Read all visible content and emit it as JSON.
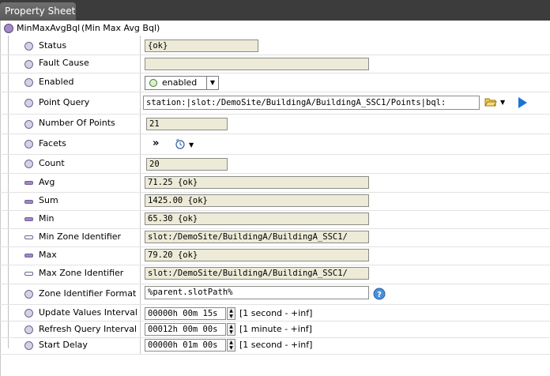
{
  "tab": {
    "label": "Property Sheet"
  },
  "root": {
    "name": "MinMaxAvgBql",
    "description": "(Min Max Avg Bql)"
  },
  "properties": {
    "status": {
      "label": "Status",
      "value": "{ok}"
    },
    "fault_cause": {
      "label": "Fault Cause",
      "value": ""
    },
    "enabled": {
      "label": "Enabled",
      "value": "enabled"
    },
    "point_query": {
      "label": "Point Query",
      "value": "station:|slot:/DemoSite/BuildingA/BuildingA_SSC1/Points|bql:"
    },
    "number_of_points": {
      "label": "Number Of Points",
      "value": "21"
    },
    "facets": {
      "label": "Facets",
      "value": "»"
    },
    "count": {
      "label": "Count",
      "value": "20"
    },
    "avg": {
      "label": "Avg",
      "value": "71.25 {ok}"
    },
    "sum": {
      "label": "Sum",
      "value": "1425.00 {ok}"
    },
    "min": {
      "label": "Min",
      "value": "65.30 {ok}"
    },
    "min_zone_identifier": {
      "label": "Min Zone Identifier",
      "value": "slot:/DemoSite/BuildingA/BuildingA_SSC1/"
    },
    "max": {
      "label": "Max",
      "value": "79.20 {ok}"
    },
    "max_zone_identifier": {
      "label": "Max Zone Identifier",
      "value": "slot:/DemoSite/BuildingA/BuildingA_SSC1/"
    },
    "zone_identifier_format": {
      "label": "Zone Identifier Format",
      "value": "%parent.slotPath%"
    },
    "update_values_interval": {
      "label": "Update Values Interval",
      "value": "00000h 00m 15s",
      "range": "[1 second - +inf]"
    },
    "refresh_query_interval": {
      "label": "Refresh Query Interval",
      "value": "00012h 00m 00s",
      "range": "[1 minute - +inf]"
    },
    "start_delay": {
      "label": "Start Delay",
      "value": "00000h 01m 00s",
      "range": "[1 second - +inf]"
    }
  },
  "icons": {
    "folder": "folder-icon",
    "play": "play-icon",
    "help": "help-icon",
    "facets_clock": "clock-icon"
  },
  "colors": {
    "accent_purple": "#a285c9",
    "play_blue": "#1a73d9",
    "field_bg": "#edebd8"
  }
}
